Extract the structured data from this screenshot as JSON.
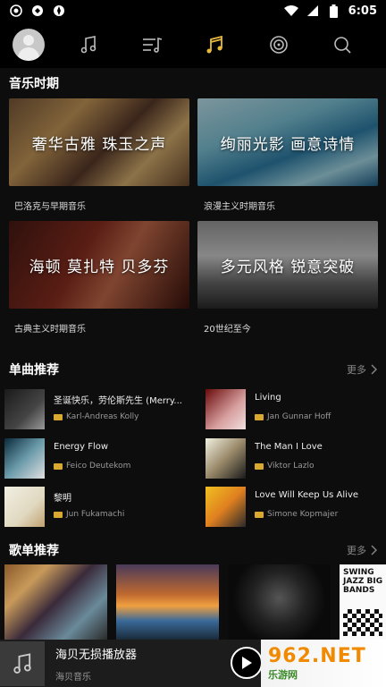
{
  "status_bar": {
    "time": "6:05",
    "left_icons": [
      "app-badge-icon",
      "sync-icon",
      "settings-wheel-icon"
    ],
    "right_icons": [
      "wifi-icon",
      "signal-icon",
      "battery-icon"
    ]
  },
  "top_nav": {
    "avatar": "avatar",
    "tabs": [
      {
        "icon": "music-note-icon",
        "active": false
      },
      {
        "icon": "playlist-icon",
        "active": false
      },
      {
        "icon": "music-notes-icon",
        "active": true
      },
      {
        "icon": "radio-icon",
        "active": false
      },
      {
        "icon": "search-icon",
        "active": false
      }
    ],
    "accent_color": "#e8b93a"
  },
  "eras": {
    "title": "音乐时期",
    "items": [
      {
        "overlay": "奢华古雅 珠玉之声",
        "label": "巴洛克与早期音乐"
      },
      {
        "overlay": "绚丽光影 画意诗情",
        "label": "浪漫主义时期音乐"
      },
      {
        "overlay": "海顿 莫扎特 贝多芬",
        "label": "古典主义时期音乐"
      },
      {
        "overlay": "多元风格 锐意突破",
        "label": "20世纪至今"
      }
    ]
  },
  "singles": {
    "title": "单曲推荐",
    "more": "更多",
    "items": [
      {
        "title": "圣诞快乐，劳伦斯先生 (Merry...",
        "artist": "Karl-Andreas Kolly"
      },
      {
        "title": "Living",
        "artist": "Jan Gunnar Hoff"
      },
      {
        "title": "Energy Flow",
        "artist": "Feico Deutekom"
      },
      {
        "title": "The Man I Love",
        "artist": "Viktor Lazlo"
      },
      {
        "title": "黎明",
        "artist": "Jun Fukamachi"
      },
      {
        "title": "Love Will Keep Us Alive",
        "artist": "Simone Kopmajer"
      }
    ]
  },
  "playlists": {
    "title": "歌单推荐",
    "more": "更多",
    "p4_text": "SWING JAZZ BIG BANDS"
  },
  "player": {
    "title": "海贝无损播放器",
    "subtitle": "海贝音乐"
  },
  "watermark": {
    "text": "962.NET",
    "sub": "乐游网"
  }
}
